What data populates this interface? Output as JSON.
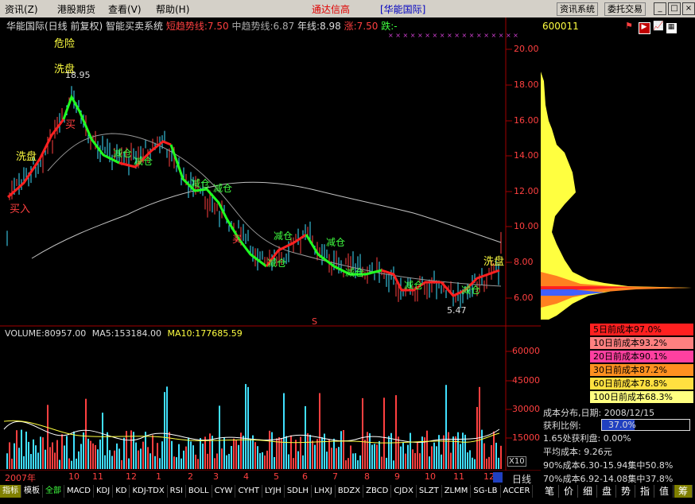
{
  "menu": {
    "items": [
      "资讯(Z)",
      "港股期货",
      "查看(V)",
      "帮助(H)"
    ],
    "brand": "通达信高",
    "brand2": "[华能国际]",
    "buttons": [
      "资讯系统",
      "委托交易"
    ]
  },
  "header": {
    "stock": "华能国际(日线 前复权)",
    "system": "智能买卖系统",
    "short": "短趋势线:7.50",
    "mid": "中趋势线:6.87",
    "year": "年线:8.98",
    "rise": "涨:7.50",
    "fall": "跌:-"
  },
  "code": "600011",
  "annotations": {
    "danger": "危险",
    "wash_top": "洗盘",
    "high": "18.95",
    "wash_left": "洗盘",
    "buy": "买入",
    "buy2": "买",
    "reduce1": "减仓",
    "reduce2": "减仓",
    "reduce3": "减仓",
    "reduce4": "减仓",
    "reduce5": "减仓",
    "reduce6": "减仓",
    "reduce7": "减仓",
    "reduce8": "减仓",
    "reduce9": "减仓",
    "reduce10": "减仓",
    "buy3": "买",
    "wash_right": "洗盘",
    "low": "5.47",
    "s": "S"
  },
  "price_axis": [
    "20.00",
    "18.00",
    "16.00",
    "14.00",
    "12.00",
    "10.00",
    "8.00",
    "6.00"
  ],
  "volume": {
    "label": "VOLUME:80957.00",
    "ma5": "MA5:153184.00",
    "ma10": "MA10:177685.59",
    "axis": [
      "60000",
      "45000",
      "30000",
      "15000"
    ],
    "x10": "X10"
  },
  "time_axis": [
    "2007年",
    "10",
    "11",
    "12",
    "1",
    "2",
    "3",
    "4",
    "5",
    "6",
    "7",
    "8",
    "9",
    "10",
    "11",
    "12"
  ],
  "period": "日线",
  "tabs": [
    "指标",
    "模板",
    "全部",
    "MACD",
    "KDJ",
    "KD",
    "KDJ-TDX",
    "RSI",
    "BOLL",
    "CYW",
    "CYHT",
    "LYJH",
    "SDLH",
    "LHXJ",
    "BDZX",
    "ZBCD",
    "CJDX",
    "SLZT",
    "ZLMM",
    "SG-LB",
    "ACCER"
  ],
  "cost": {
    "rows": [
      "5日前成本97.0%",
      "10日前成本93.2%",
      "20日前成本90.1%",
      "30日前成本87.2%",
      "60日前成本78.8%",
      "100日前成本68.3%"
    ],
    "colors": [
      "#ff2020",
      "#ff8080",
      "#ff40a0",
      "#ff9020",
      "#ffe040",
      "#ffff80"
    ]
  },
  "info": {
    "date": "成本分布,日期: 2008/12/15",
    "profit_label": "获利比例:",
    "profit_value": "37.0%",
    "profit_fraction": 0.37,
    "price_profit": "1.65处获利盘: 0.00%",
    "avg": "平均成本: 9.26元",
    "c90": "90%成本6.30-15.94集中50.8%",
    "c70": "70%成本6.92-14.08集中37.8%"
  },
  "bottom_tabs": [
    "笔",
    "价",
    "细",
    "盘",
    "势",
    "指",
    "值",
    "筹"
  ]
}
